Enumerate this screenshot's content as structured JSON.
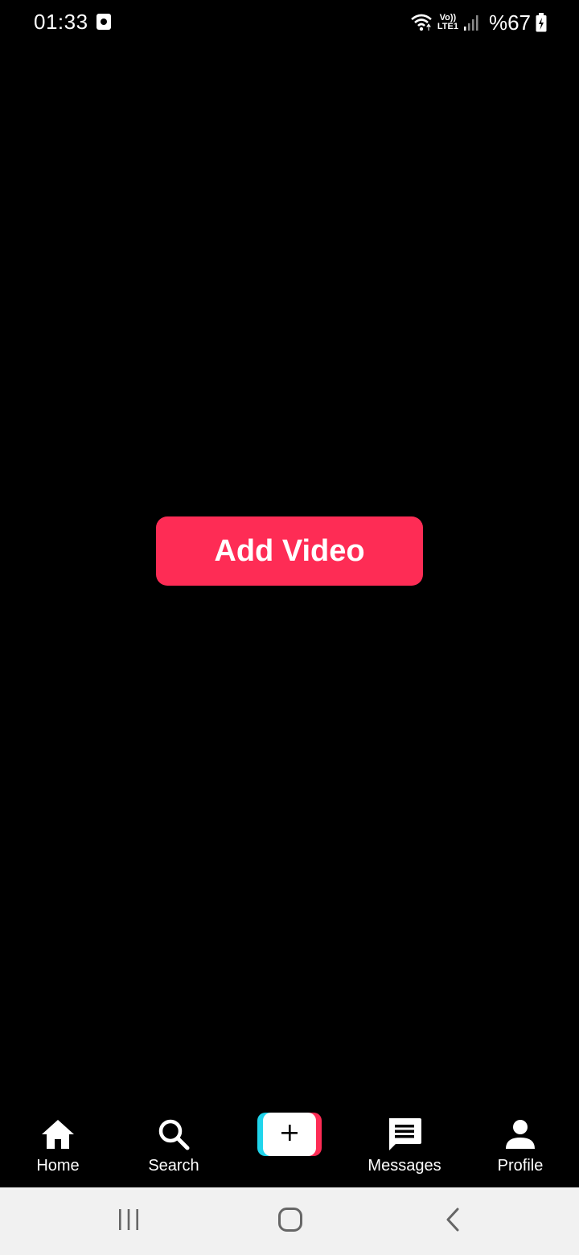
{
  "status_bar": {
    "time": "01:33",
    "network_top": "Vo))",
    "network_bottom": "LTE1",
    "battery": "%67"
  },
  "main": {
    "add_video_label": "Add Video"
  },
  "tab_bar": {
    "tabs": [
      {
        "label": "Home",
        "icon": "home-icon"
      },
      {
        "label": "Search",
        "icon": "search-icon"
      },
      {
        "label": "",
        "icon": "plus-icon"
      },
      {
        "label": "Messages",
        "icon": "message-icon"
      },
      {
        "label": "Profile",
        "icon": "person-icon"
      }
    ]
  },
  "colors": {
    "accent": "#fe2c55",
    "cyan": "#20d5ec",
    "background": "#000000",
    "nav_bar": "#f1f1f1"
  }
}
